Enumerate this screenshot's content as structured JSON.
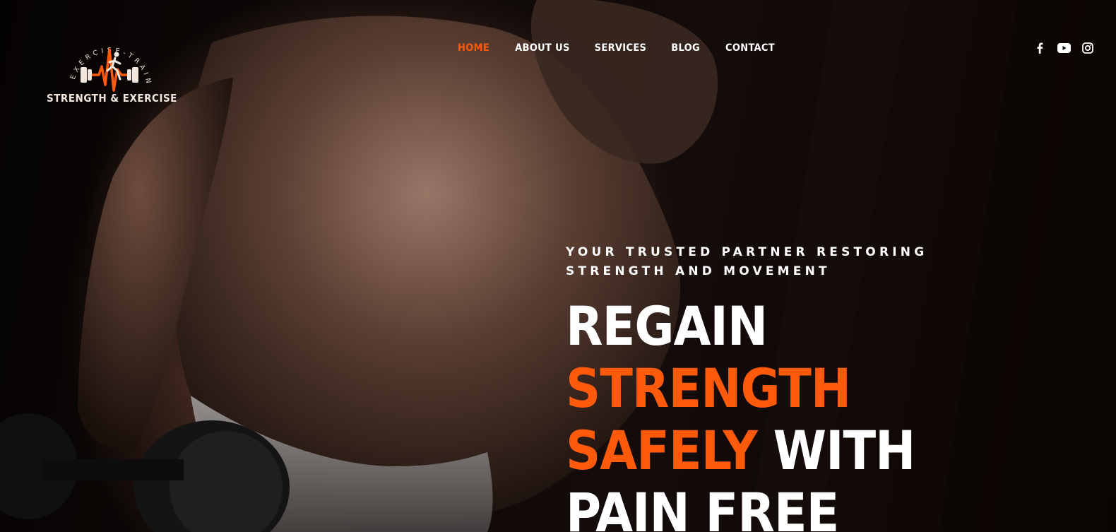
{
  "brand": {
    "arc_text": "EXERCISE-TRAINING",
    "name": "STRENGTH & EXERCISE",
    "accent_color": "#ff5a0a"
  },
  "nav": {
    "items": [
      {
        "label": "HOME",
        "active": true
      },
      {
        "label": "ABOUT US",
        "active": false
      },
      {
        "label": "SERVICES",
        "active": false
      },
      {
        "label": "BLOG",
        "active": false
      },
      {
        "label": "CONTACT",
        "active": false
      }
    ]
  },
  "social": {
    "icons": [
      "facebook-icon",
      "youtube-icon",
      "instagram-icon"
    ]
  },
  "hero": {
    "tagline_line1": "YOUR TRUSTED PARTNER RESTORING",
    "tagline_line2": "STRENGTH AND MOVEMENT",
    "headline": {
      "line1": "REGAIN",
      "line2": "STRENGTH",
      "line3_accent": "SAFELY",
      "line3_rest": " WITH",
      "line4": "PAIN FREE"
    }
  }
}
